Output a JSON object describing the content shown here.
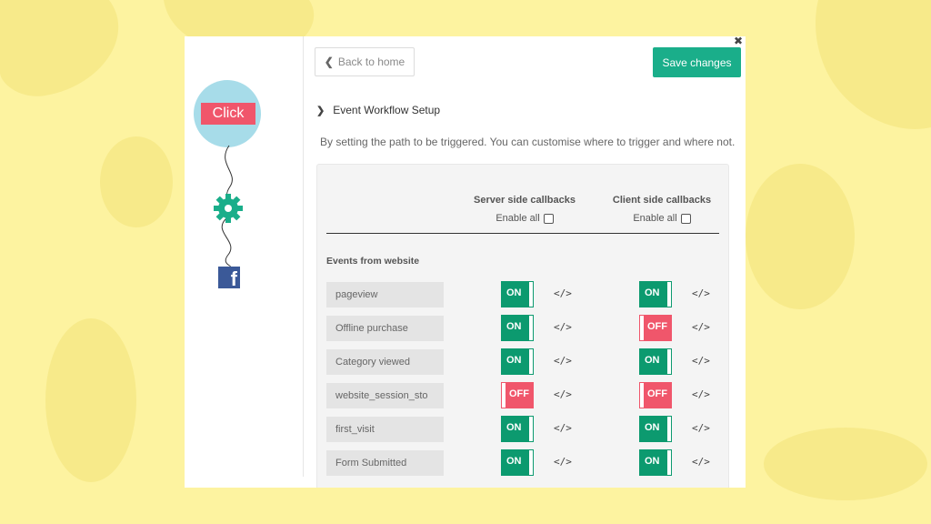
{
  "flow": {
    "click_label": "Click",
    "gear_icon": "gear-icon",
    "facebook_icon": "facebook-icon",
    "facebook_glyph": "f",
    "accent": "#f0566b",
    "circle_color": "#a7dce9",
    "gear_color": "#1aae8a"
  },
  "header": {
    "back_label": "Back to home",
    "save_label": "Save changes",
    "save_color": "#1aae8a"
  },
  "section": {
    "title": "Event Workflow Setup",
    "description": "By setting the path to be triggered. You can customise where to trigger and where not."
  },
  "table": {
    "server_header": "Server side callbacks",
    "client_header": "Client side callbacks",
    "enable_all_label": "Enable all",
    "events_header": "Events from website",
    "code_glyph": "</>",
    "on_color": "#0c9a6f",
    "off_color": "#f0566b",
    "rows": [
      {
        "name": "pageview",
        "server": "ON",
        "client": "ON"
      },
      {
        "name": "Offline purchase",
        "server": "ON",
        "client": "OFF"
      },
      {
        "name": "Category viewed",
        "server": "ON",
        "client": "ON"
      },
      {
        "name": "website_session_sto",
        "server": "OFF",
        "client": "OFF"
      },
      {
        "name": "first_visit",
        "server": "ON",
        "client": "ON"
      },
      {
        "name": "Form Submitted",
        "server": "ON",
        "client": "ON"
      }
    ]
  }
}
